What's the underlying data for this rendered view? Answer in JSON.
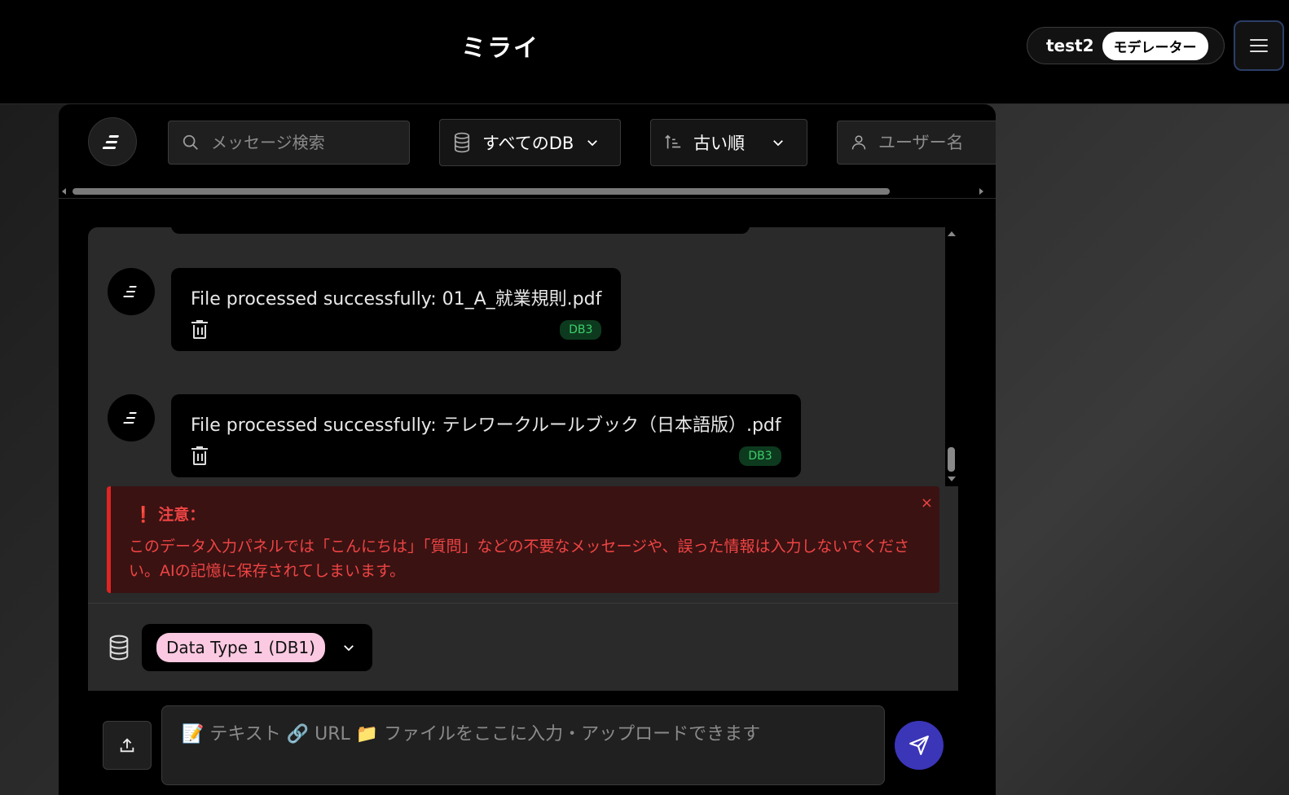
{
  "header": {
    "title": "ミライ",
    "user_name": "test2",
    "role": "モデレーター"
  },
  "filters": {
    "search_placeholder": "メッセージ検索",
    "db_filter": "すべてのDB",
    "sort_order": "古い順",
    "user_placeholder": "ユーザー名"
  },
  "messages": [
    {
      "text": "File processed successfully: 01_A_就業規則.pdf",
      "db": "DB3"
    },
    {
      "text": "File processed successfully: テレワークルールブック（日本語版）.pdf",
      "db": "DB3"
    }
  ],
  "warning": {
    "title": "注意：",
    "body": "このデータ入力パネルでは「こんにちは」「質問」などの不要なメッセージや、誤った情報は入力しないでください。AIの記憶に保存されてしまいます。",
    "close": "×"
  },
  "data_type": {
    "selected": "Data Type 1 (DB1)"
  },
  "composer": {
    "placeholder": "📝 テキスト 🔗 URL 📁 ファイルをここに入力・アップロードできます"
  },
  "colors": {
    "accent": "#3b35b8",
    "warning": "#ef4444",
    "db_badge": "#3ccf6b",
    "type_chip": "#fbc9e1"
  }
}
